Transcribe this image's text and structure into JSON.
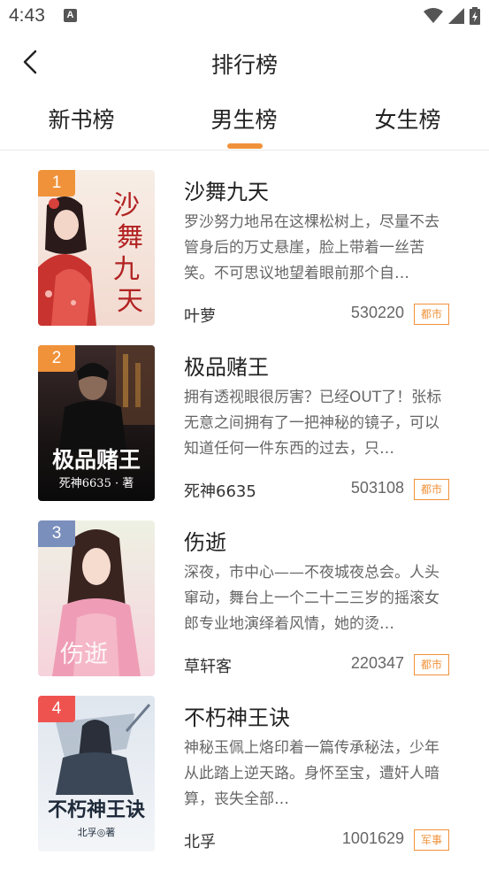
{
  "status_bar": {
    "time": "4:43",
    "notif_letter": "A"
  },
  "header": {
    "title": "排行榜"
  },
  "tabs": [
    {
      "label": "新书榜",
      "active": false
    },
    {
      "label": "男生榜",
      "active": true
    },
    {
      "label": "女生榜",
      "active": false
    }
  ],
  "colors": {
    "accent": "#f0923a",
    "rank_1": "#f0923a",
    "rank_2": "#f0923a",
    "rank_3": "#7b8fbd",
    "rank_4": "#ef5350"
  },
  "books": [
    {
      "rank": "1",
      "title": "沙舞九天",
      "description": "罗沙努力地吊在这棵松树上，尽量不去管身后的万丈悬崖，脸上带着一丝苦笑。不可思议地望着眼前那个自…",
      "author": "叶萝",
      "count": "530220",
      "tag": "都市",
      "cover_text": "沙舞九天"
    },
    {
      "rank": "2",
      "title": "极品赌王",
      "description": "拥有透视眼很厉害？已经OUT了！张标无意之间拥有了一把神秘的镜子，可以知道任何一件东西的过去，只…",
      "author": "死神6635",
      "count": "503108",
      "tag": "都市",
      "cover_text": "极品赌王",
      "cover_sub": "死神6635 · 著"
    },
    {
      "rank": "3",
      "title": "伤逝",
      "description": "深夜，市中心——不夜城夜总会。人头窜动，舞台上一个二十二三岁的摇滚女郎专业地演绎着风情，她的烫…",
      "author": "草轩客",
      "count": "220347",
      "tag": "都市",
      "cover_text": "伤逝"
    },
    {
      "rank": "4",
      "title": "不朽神王诀",
      "description": "神秘玉佩上烙印着一篇传承秘法，少年从此踏上逆天路。身怀至宝，遭奸人暗算，丧失全部…",
      "author": "北孚",
      "count": "1001629",
      "tag": "军事",
      "cover_text": "不朽神王诀",
      "cover_sub": "北孚◎著"
    }
  ]
}
